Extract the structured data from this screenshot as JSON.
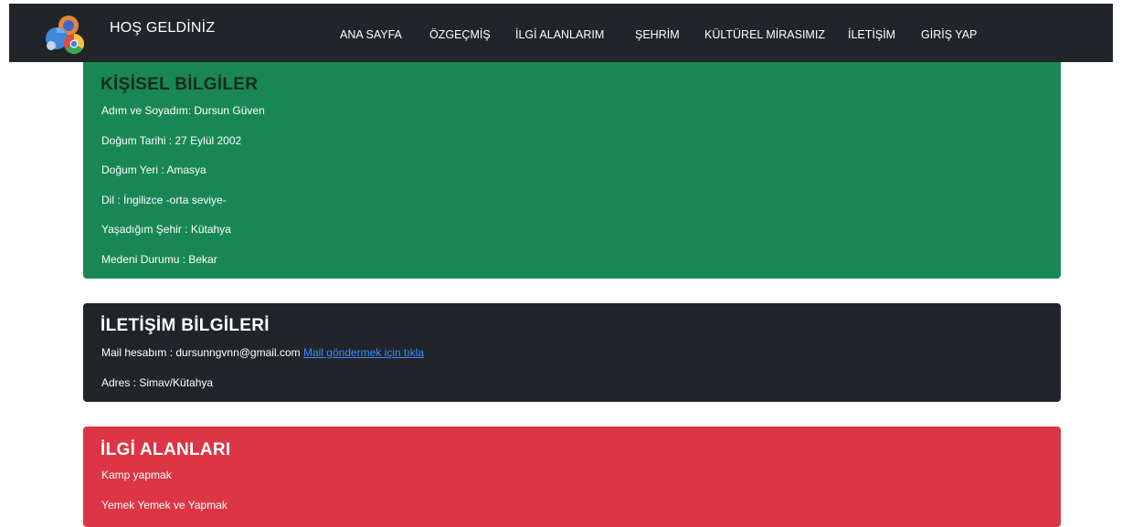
{
  "header": {
    "brand": "HOŞ GELDİNİZ",
    "nav": [
      {
        "label": "ANA SAYFA"
      },
      {
        "label": "ÖZGEÇMİŞ"
      },
      {
        "label": "İLGİ ALANLARIM"
      },
      {
        "label": "ŞEHRİM"
      },
      {
        "label": "KÜLTÜREL MİRASIMIZ"
      },
      {
        "label": "İLETİŞİM"
      },
      {
        "label": "GİRİŞ YAP"
      }
    ]
  },
  "personal": {
    "title": "KİŞİSEL BİLGİLER",
    "lines": [
      "Adım ve Soyadım: Dursun Güven",
      "Doğum Tarihi : 27 Eylül 2002",
      "Doğum Yeri : Amasya",
      "Dil : İngilizce -orta seviye-",
      "Yaşadığım Şehir : Kütahya",
      "Medeni Durumu : Bekar"
    ]
  },
  "contact": {
    "title": "İLETİŞİM BİLGİLERİ",
    "mail_text": "Mail hesabım : dursunngvnn@gmail.com",
    "mail_link": "Mail göndermek için tıkla",
    "address": "Adres : Simav/Kütahya"
  },
  "interests": {
    "title": "İLGİ ALANLARI",
    "lines": [
      "Kamp yapmak",
      "Yemek Yemek ve Yapmak"
    ]
  },
  "colors": {
    "navbar": "#212529",
    "personal_bg": "#198754",
    "contact_bg": "#212529",
    "interests_bg": "#dc3545",
    "link": "#3d8bfd"
  }
}
